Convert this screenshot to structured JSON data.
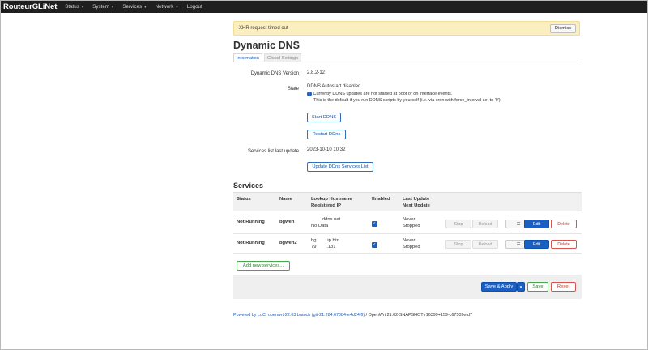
{
  "navbar": {
    "brand": "RouteurGLiNet",
    "menu": [
      "Status",
      "System",
      "Services",
      "Network"
    ],
    "logout": "Logout"
  },
  "alert": {
    "text": "XHR request timed out",
    "dismiss": "Dismiss"
  },
  "page": {
    "title": "Dynamic DNS",
    "tabs": [
      "Information",
      "Global Settings"
    ]
  },
  "info": {
    "version_label": "Dynamic DNS Version",
    "version_value": "2.8.2-12",
    "state_label": "State",
    "state_value": "DDNS Autostart disabled",
    "state_note_1": "Currently DDNS updates are not started at boot or on interface events.",
    "state_note_2": "This is the default if you run DDNS scripts by yourself (i.e. via cron with force_interval set to '0')",
    "start_btn": "Start DDNS",
    "restart_btn": "Restart DDns",
    "services_update_label": "Services list last update",
    "services_update_value": "2023-10-10 10:32",
    "update_list_btn": "Update DDns Services List"
  },
  "services": {
    "title": "Services",
    "headers": {
      "status": "Status",
      "name": "Name",
      "lookup": "Lookup Hostname",
      "registered": "Registered IP",
      "enabled": "Enabled",
      "last_update": "Last Update",
      "next_update": "Next Update"
    },
    "rows": [
      {
        "status": "Not Running",
        "name": "bgwen",
        "hostname": "            ddns.net",
        "ip": "No Data",
        "last": "Never",
        "next": "Stopped"
      },
      {
        "status": "Not Running",
        "name": "bgwen2",
        "hostname": "bg            ip.biz",
        "ip": "79           .131",
        "last": "Never",
        "next": "Stopped"
      }
    ],
    "row_buttons": {
      "stop": "Stop",
      "reload": "Reload",
      "menu": "☰",
      "edit": "Edit",
      "delete": "Delete"
    },
    "add_btn": "Add new services..."
  },
  "footer_actions": {
    "apply": "Save & Apply",
    "save": "Save",
    "reset": "Reset"
  },
  "powered": {
    "link": "Powered by LuCI openwrt-22.03 branch (git-21.284.67084-e4d24f6)",
    "rest": " / OpenWrt 21.02-SNAPSHOT r16399+159-c67509efd7"
  },
  "colors": {
    "primary": "#1a5fc4",
    "danger": "#d9534f",
    "success": "#4aa64a",
    "alert_bg": "#fbeec1",
    "navbar": "#1f1f1f"
  }
}
